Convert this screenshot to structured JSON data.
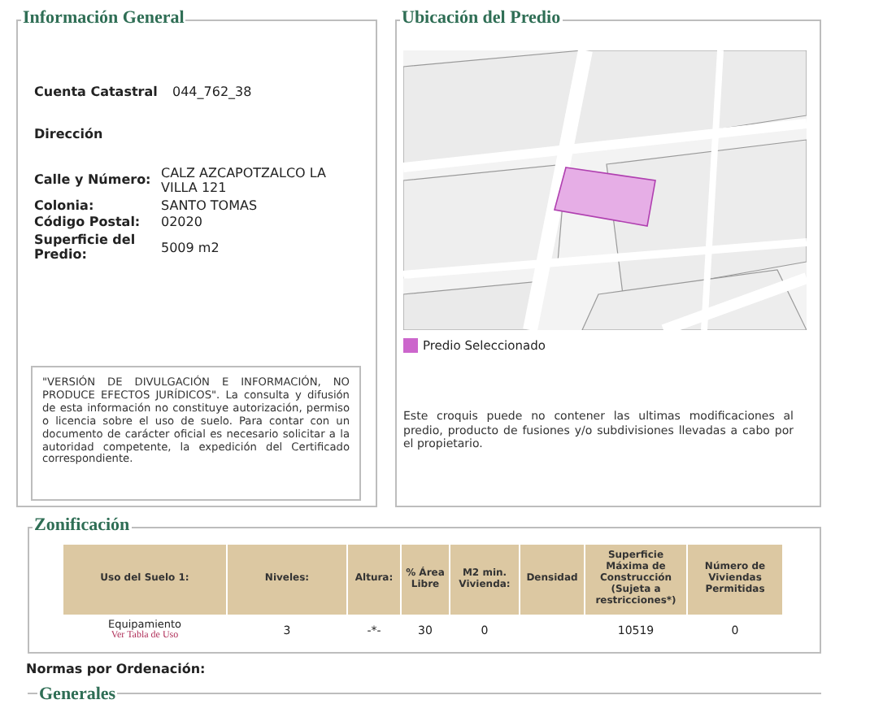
{
  "informacion_general": {
    "legend": "Información General",
    "cuenta": {
      "label": "Cuenta Catastral",
      "value": "044_762_38"
    },
    "direccion_heading": "Dirección",
    "address_fields": [
      {
        "label": "Calle y Número:",
        "value": "CALZ AZCAPOTZALCO LA VILLA 121"
      },
      {
        "label": "Colonia:",
        "value": "SANTO TOMAS"
      },
      {
        "label": "Código Postal:",
        "value": "02020"
      },
      {
        "label": "Superficie del Predio:",
        "value": "5009 m2"
      }
    ],
    "disclaimer": "\"VERSIÓN DE DIVULGACIÓN E INFORMACIÓN, NO PRODUCE EFECTOS JURÍDICOS\". La consulta y difusión de esta información no constituye autorización, permiso o licencia sobre el uso de suelo. Para contar con un documento de carácter oficial es necesario solicitar a la autoridad competente, la expedición del Certificado correspondiente."
  },
  "ubicacion": {
    "legend": "Ubicación del Predio",
    "map_key": {
      "label": "Predio Seleccionado",
      "color": "#cc66cc"
    },
    "note": "Este croquis puede no contener las ultimas modificaciones al predio, producto de fusiones y/o subdivisiones llevadas a cabo por el propietario."
  },
  "zonificacion": {
    "legend": "Zonificación",
    "columns": [
      "Uso del Suelo 1:",
      "Niveles:",
      "Altura:",
      "% Área Libre",
      "M2 min. Vivienda:",
      "Densidad",
      "Superficie Máxima de Construcción (Sujeta a restricciones*)",
      "Número de Viviendas Permitidas"
    ],
    "rows": [
      {
        "link": "Ver Tabla de Uso",
        "cells": [
          "Equipamiento",
          "3",
          "-*-",
          "30",
          "0",
          "",
          "10519",
          "0"
        ]
      }
    ]
  },
  "normas_heading": "Normas por Ordenación:",
  "generales_legend": "Generales"
}
